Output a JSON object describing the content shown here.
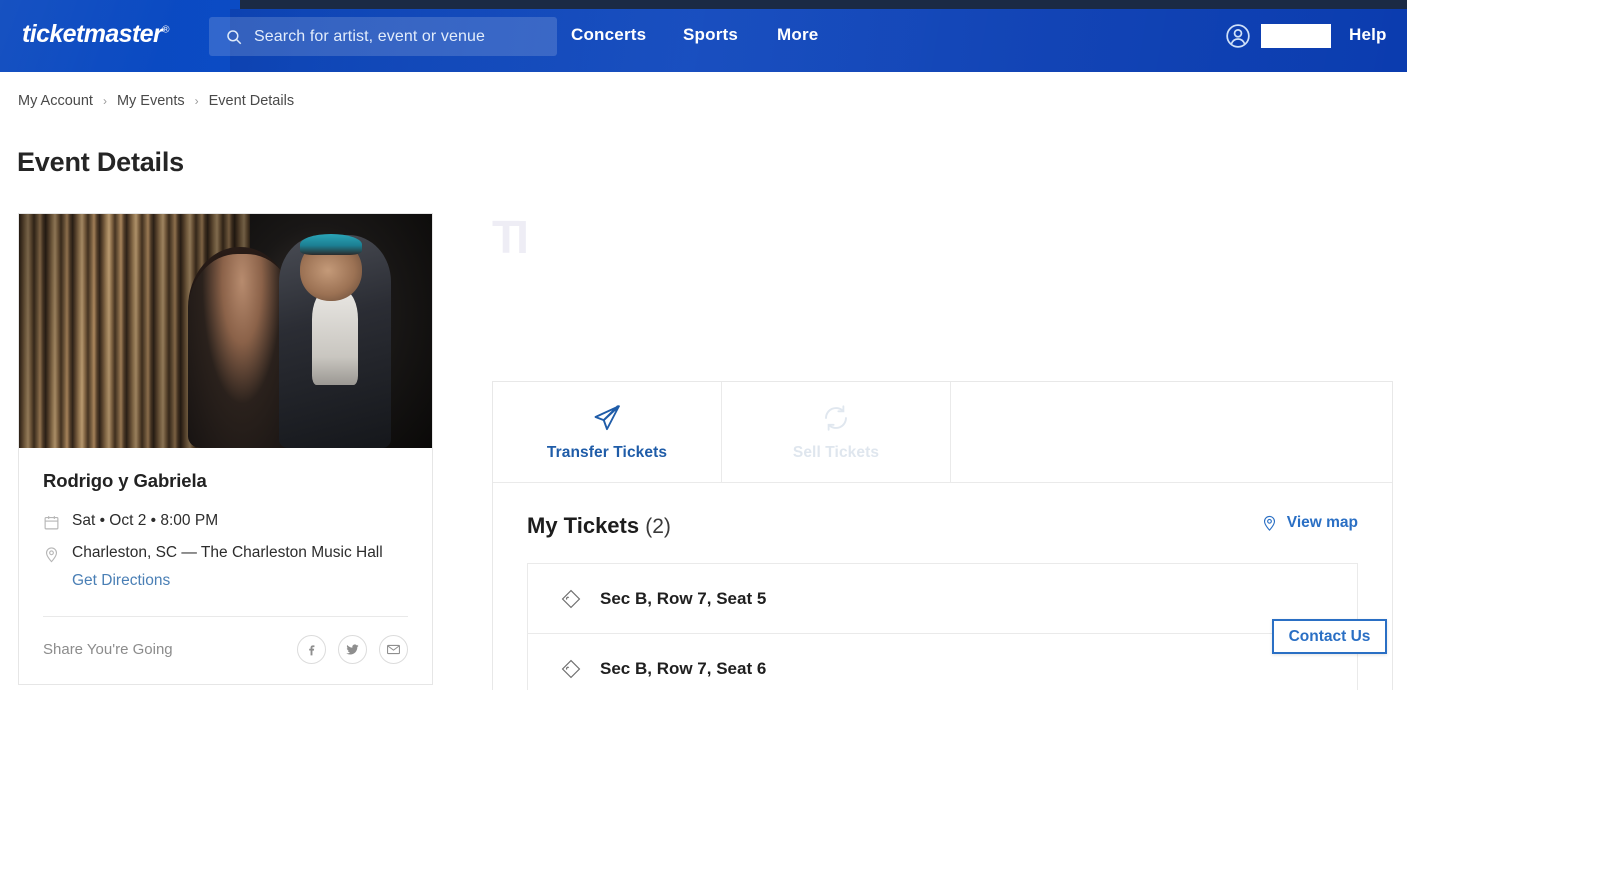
{
  "colors": {
    "header_blue": "#0b47bd",
    "header_top_strip": "#1b2a44",
    "link_blue": "#2a6fc4",
    "tab_active_blue": "#1f5ca8",
    "tab_disabled": "#dfe6ee",
    "text_dark": "#1f1f1f",
    "muted": "#8c8c8c"
  },
  "header": {
    "logo_text": "ticketmaster",
    "logo_reg": "®",
    "search": {
      "placeholder": "Search for artist, event or venue",
      "value": "",
      "icon": "search-icon"
    },
    "nav": [
      {
        "label": "Concerts"
      },
      {
        "label": "Sports"
      },
      {
        "label": "More"
      }
    ],
    "account": {
      "icon": "account-circle-icon",
      "username_redacted": ""
    },
    "help_label": "Help"
  },
  "breadcrumb": {
    "items": [
      {
        "label": "My Account"
      },
      {
        "label": "My Events"
      },
      {
        "label": "Event Details"
      }
    ],
    "separator": "›"
  },
  "page": {
    "title": "Event Details"
  },
  "event_card": {
    "image_alt": "Rodrigo y Gabriela promotional photo",
    "name": "Rodrigo y Gabriela",
    "date_icon": "calendar-icon",
    "date_text": "Sat • Oct 2 • 8:00 PM",
    "location_icon": "map-pin-icon",
    "location_text": "Charleston, SC — The Charleston Music Hall",
    "directions_label": "Get Directions",
    "share_label": "Share You're Going",
    "share_icons": [
      {
        "name": "facebook-icon",
        "glyph": "f"
      },
      {
        "name": "twitter-icon",
        "glyph": ""
      },
      {
        "name": "email-icon",
        "glyph": "✉"
      }
    ]
  },
  "action_tabs": [
    {
      "label": "Transfer Tickets",
      "icon": "paper-plane-icon",
      "state": "enabled"
    },
    {
      "label": "Sell Tickets",
      "icon": "refresh-circle-icon",
      "state": "disabled"
    }
  ],
  "tickets": {
    "heading": "My Tickets",
    "count_label": "(2)",
    "view_map": {
      "label": "View map",
      "icon": "map-pin-icon"
    },
    "rows": [
      {
        "icon": "ticket-diamond-icon",
        "label": "Sec B, Row 7, Seat 5"
      },
      {
        "icon": "ticket-diamond-icon",
        "label": "Sec B, Row 7, Seat 6"
      }
    ]
  },
  "contact_widget": {
    "label": "Contact Us"
  },
  "artifact": {
    "ghost_text": "TI"
  }
}
